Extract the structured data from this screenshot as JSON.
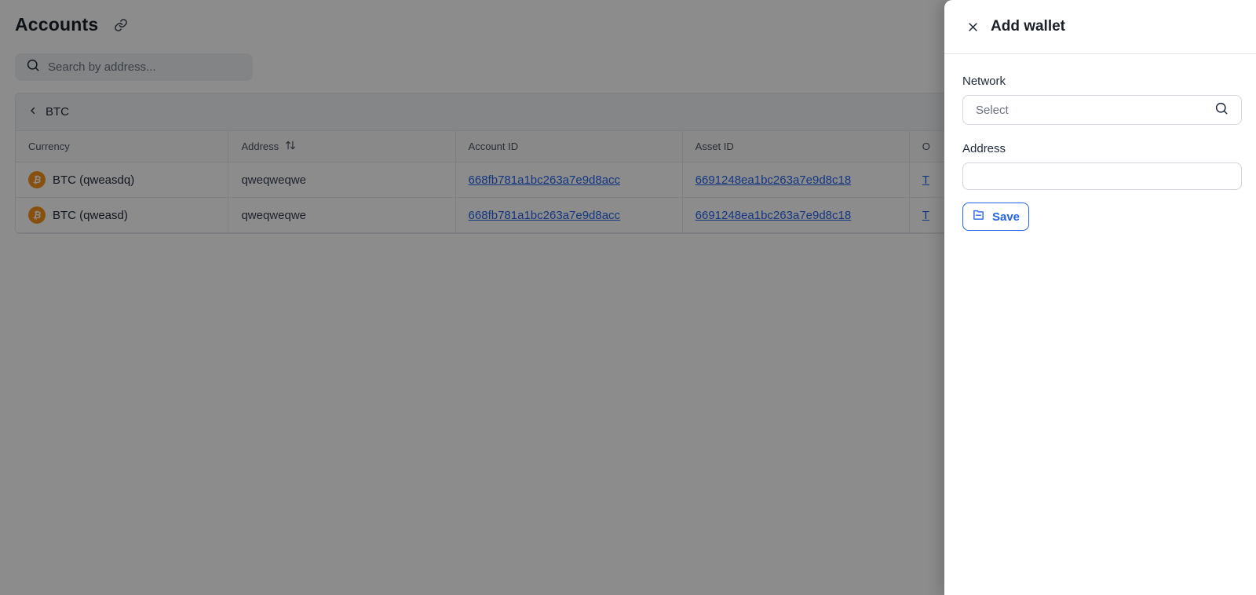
{
  "page": {
    "title": "Accounts",
    "search_placeholder": "Search by address..."
  },
  "table": {
    "group_label": "BTC",
    "columns": [
      "Currency",
      "Address",
      "Account ID",
      "Asset ID",
      "O"
    ],
    "rows": [
      {
        "currency": "BTC (qweasdq)",
        "address": "qweqweqwe",
        "account_id": "668fb781a1bc263a7e9d8acc",
        "asset_id": "6691248ea1bc263a7e9d8c18",
        "extra": "T"
      },
      {
        "currency": "BTC (qweasd)",
        "address": "qweqweqwe",
        "account_id": "668fb781a1bc263a7e9d8acc",
        "asset_id": "6691248ea1bc263a7e9d8c18",
        "extra": "T"
      }
    ],
    "coin_glyph": "₿"
  },
  "drawer": {
    "title": "Add wallet",
    "network_label": "Network",
    "network_placeholder": "Select",
    "address_label": "Address",
    "address_value": "",
    "save_label": "Save"
  },
  "colors": {
    "accent": "#2563eb",
    "btc": "#f7931a",
    "overlay": "rgba(0,0,0,0.45)"
  },
  "icons": [
    "link-icon",
    "search-icon",
    "chevron-left-icon",
    "sort-icon",
    "bitcoin-icon",
    "close-icon",
    "save-icon"
  ]
}
